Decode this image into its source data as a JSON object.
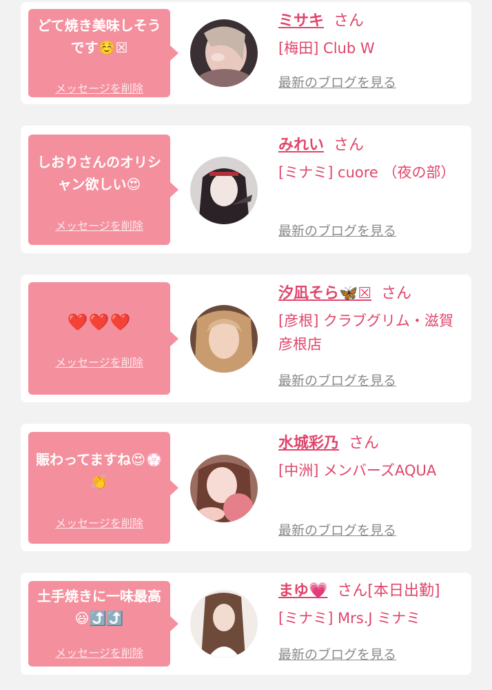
{
  "messages": [
    {
      "message": "どて焼き美味しそうです☺️☒",
      "delete_label": "メッセージを削除",
      "name": "ミサキ",
      "honorific": "さん",
      "shop": "[梅田] Club W",
      "blog_label": "最新のブログを見る",
      "avatar_colors": [
        "#e9c8c0",
        "#8a6a6a"
      ]
    },
    {
      "message": "しおりさんのオリシャン欲しい😍",
      "delete_label": "メッセージを削除",
      "name": "みれい",
      "honorific": "さん",
      "shop": "[ミナミ] cuore （夜の部）",
      "blog_label": "最新のブログを見る",
      "avatar_colors": [
        "#d8d4d4",
        "#2a2226"
      ]
    },
    {
      "message": "❤️❤️❤️",
      "delete_label": "メッセージを削除",
      "name": "汐凪そら🦋☒",
      "honorific": "さん",
      "shop": "[彦根] クラブグリム・滋賀彦根店",
      "blog_label": "最新のブログを見る",
      "avatar_colors": [
        "#6a4a3a",
        "#d9b590"
      ]
    },
    {
      "message": "賑わってますね😍💮👏",
      "delete_label": "メッセージを削除",
      "name": "水城彩乃",
      "honorific": "さん",
      "shop": "[中洲] メンバーズAQUA",
      "blog_label": "最新のブログを見る",
      "avatar_colors": [
        "#e5b8b2",
        "#9b6c60"
      ]
    },
    {
      "message": "土手焼きに一味最高😃⤴️⤴️",
      "delete_label": "メッセージを削除",
      "name": "まゆ💗",
      "honorific": "さん[本日出勤]",
      "shop": "[ミナミ] Mrs.J ミナミ",
      "blog_label": "最新のブログを見る",
      "avatar_colors": [
        "#f1ece8",
        "#6e4a3a"
      ]
    }
  ],
  "colors": {
    "page_background": "#f2f2f2",
    "card_background": "#ffffff",
    "bubble": "#f4909e",
    "accent": "#e0456a",
    "link_gray": "#8a8a8a"
  }
}
